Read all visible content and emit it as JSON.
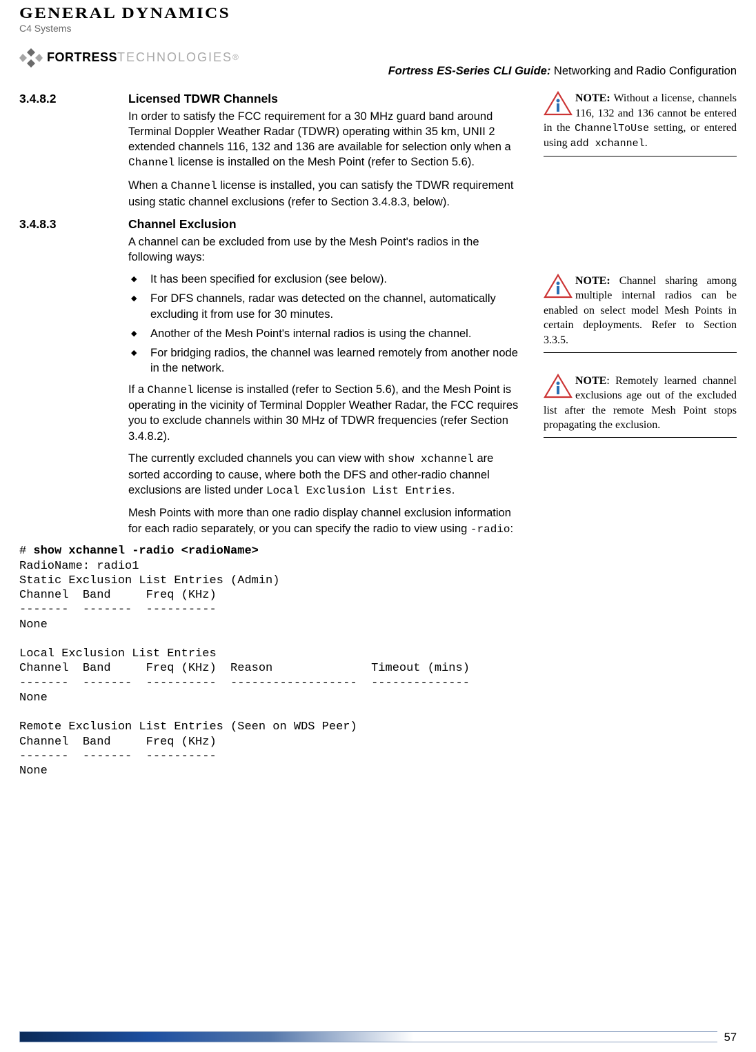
{
  "header": {
    "company": "GENERAL DYNAMICS",
    "subunit": "C4 Systems",
    "brand_a": "FORTRESS",
    "brand_b": "TECHNOLOGIES",
    "guide_bold": "Fortress ES-Series CLI Guide:",
    "guide_rest": " Networking and Radio Configuration"
  },
  "sections": {
    "s1": {
      "num": "3.4.8.2",
      "title": "Licensed TDWR Channels",
      "p1a": "In order to satisfy the FCC requirement for a 30 MHz guard band around Terminal Doppler Weather Radar (TDWR) operating within 35 km, UNII 2 extended channels 116, 132 and 136 are available for selection only when a ",
      "p1code": "Channel",
      "p1b": " license is installed on the Mesh Point (refer to Section 5.6).",
      "p2a": "When a ",
      "p2code": "Channel",
      "p2b": " license is installed, you can satisfy the TDWR requirement using static channel exclusions (refer to Section 3.4.8.3, below)."
    },
    "s2": {
      "num": "3.4.8.3",
      "title": "Channel Exclusion",
      "p1": "A channel can be excluded from use by the Mesh Point's radios in the following ways:",
      "b1": "It has been specified for exclusion (see below).",
      "b2": "For DFS channels, radar was detected on the channel, automatically excluding it from use for 30 minutes.",
      "b3": "Another of the Mesh Point's internal radios is using the channel.",
      "b4": "For bridging radios, the channel was learned remotely from another node in the network.",
      "p2a": "If a ",
      "p2code": "Channel",
      "p2b": " license is installed (refer to Section 5.6), and the Mesh Point is operating in the vicinity of Terminal Doppler Weather Radar, the FCC requires you to exclude channels within 30 MHz of TDWR frequencies (refer Section 3.4.8.2).",
      "p3a": "The currently excluded channels you can view with ",
      "p3code1": "show xchannel",
      "p3b": " are sorted according to cause, where both the DFS and other-radio channel exclusions are listed under ",
      "p3code2": "Local Exclusion List Entries",
      "p3c": ".",
      "p4a": "Mesh Points with more than one radio display channel exclusion information for each radio separately, or you can specify the radio to view using ",
      "p4code": "-radio",
      "p4b": ":"
    }
  },
  "notes": {
    "n1": {
      "label": "NOTE:",
      "t1": " Without a license, channels 116, 132 and 136 cannot be entered in the ",
      "code1": "ChannelToUse",
      "t2": " setting, or entered using ",
      "code2": "add xchannel",
      "t3": "."
    },
    "n2": {
      "label": "NOTE:",
      "text": " Channel sharing among multiple internal radios can be enabled on select model Mesh Points in certain deployments. Refer to Section 3.3.5."
    },
    "n3": {
      "label": "NOTE",
      "text": ": Remotely learned channel exclusions age out of the excluded list after the remote Mesh Point stops propagating the exclusion."
    }
  },
  "code": {
    "prompt": "# ",
    "cmd": "show xchannel -radio <radioName>",
    "body": "RadioName: radio1\nStatic Exclusion List Entries (Admin)\nChannel  Band     Freq (KHz)\n-------  -------  ----------\nNone\n\nLocal Exclusion List Entries\nChannel  Band     Freq (KHz)  Reason              Timeout (mins)\n-------  -------  ----------  ------------------  --------------\nNone\n\nRemote Exclusion List Entries (Seen on WDS Peer)\nChannel  Band     Freq (KHz)\n-------  -------  ----------\nNone"
  },
  "page_number": "57"
}
